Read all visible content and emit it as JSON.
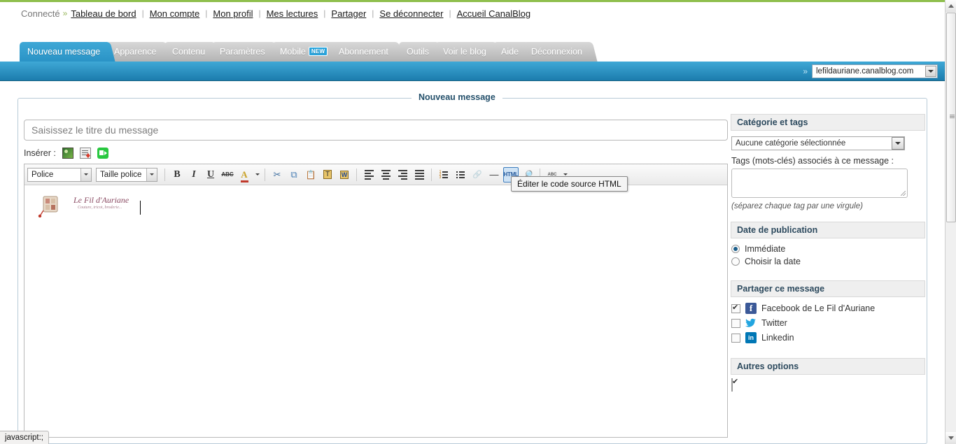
{
  "topbar": {
    "connected_label": "Connecté",
    "chevron": "»",
    "separator": "|",
    "links": [
      "Tableau de bord",
      "Mon compte",
      "Mon profil",
      "Mes lectures",
      "Partager",
      "Se déconnecter",
      "Accueil CanalBlog"
    ]
  },
  "tabs": [
    {
      "label": "Nouveau message",
      "active": true,
      "badge": null
    },
    {
      "label": "Apparence",
      "active": false,
      "badge": null
    },
    {
      "label": "Contenu",
      "active": false,
      "badge": null
    },
    {
      "label": "Paramètres",
      "active": false,
      "badge": null
    },
    {
      "label": "Mobile",
      "active": false,
      "badge": "NEW"
    },
    {
      "label": "Abonnement",
      "active": false,
      "badge": null
    },
    {
      "label": "Outils",
      "active": false,
      "badge": null
    },
    {
      "label": "Voir le blog",
      "active": false,
      "badge": null
    },
    {
      "label": "Aide",
      "active": false,
      "badge": null
    },
    {
      "label": "Déconnexion",
      "active": false,
      "badge": null
    }
  ],
  "bluebar": {
    "chevron": "»",
    "blog_select_value": "lefildauriane.canalblog.com"
  },
  "main": {
    "legend": "Nouveau message",
    "title_placeholder": "Saisissez le titre du message",
    "title_value": "",
    "inserer_label": "Insérer :",
    "insert_icons": [
      "insert-image-icon",
      "insert-document-icon",
      "insert-video-icon"
    ]
  },
  "editor": {
    "font_select": "Police",
    "size_select": "Taille police",
    "buttons": [
      {
        "name": "bold",
        "glyph": "B"
      },
      {
        "name": "italic",
        "glyph": "I"
      },
      {
        "name": "underline",
        "glyph": "U"
      },
      {
        "name": "strikethrough",
        "glyph": "ABC"
      },
      {
        "name": "text-color",
        "glyph": "A"
      },
      {
        "name": "cut",
        "glyph": "✂"
      },
      {
        "name": "copy",
        "glyph": "⧉"
      },
      {
        "name": "paste",
        "glyph": "📋"
      },
      {
        "name": "paste-text",
        "glyph": "T"
      },
      {
        "name": "paste-word",
        "glyph": "W"
      },
      {
        "name": "align-left",
        "glyph": ""
      },
      {
        "name": "align-center",
        "glyph": ""
      },
      {
        "name": "align-right",
        "glyph": ""
      },
      {
        "name": "align-justify",
        "glyph": ""
      },
      {
        "name": "ordered-list",
        "glyph": ""
      },
      {
        "name": "unordered-list",
        "glyph": ""
      },
      {
        "name": "link",
        "glyph": "🔗"
      },
      {
        "name": "horizontal-rule",
        "glyph": "—"
      },
      {
        "name": "html-source",
        "glyph": "HTML"
      },
      {
        "name": "preview",
        "glyph": "🔍"
      },
      {
        "name": "spellcheck",
        "glyph": "ABC"
      }
    ],
    "active_button": "html-source",
    "tooltip": "Éditer le code source HTML",
    "signature": {
      "line1": "Le Fil d'Auriane",
      "line2": "Couture, tricot, broderie..."
    }
  },
  "sidebar": {
    "category_panel": {
      "title": "Catégorie et tags",
      "category_value": "Aucune catégorie sélectionnée",
      "tags_label": "Tags (mots-clés) associés à ce message :",
      "tags_value": "",
      "tags_hint": "(séparez chaque tag par une virgule)"
    },
    "date_panel": {
      "title": "Date de publication",
      "options": [
        {
          "label": "Immédiate",
          "selected": true
        },
        {
          "label": "Choisir la date",
          "selected": false
        }
      ]
    },
    "share_panel": {
      "title": "Partager ce message",
      "items": [
        {
          "label": "Facebook de Le Fil d'Auriane",
          "checked": true,
          "icon": "facebook-icon"
        },
        {
          "label": "Twitter",
          "checked": false,
          "icon": "twitter-icon"
        },
        {
          "label": "Linkedin",
          "checked": false,
          "icon": "linkedin-icon"
        }
      ]
    },
    "other_panel": {
      "title": "Autres options"
    }
  },
  "statusbar": {
    "text": "javascript:;"
  },
  "colors": {
    "accent_blue": "#3fa8d6",
    "accent_blue_dark": "#1b7cad",
    "green_strip": "#8fbf4d",
    "tab_inactive": "#c4c4c4",
    "panel_head": "#efefef"
  }
}
